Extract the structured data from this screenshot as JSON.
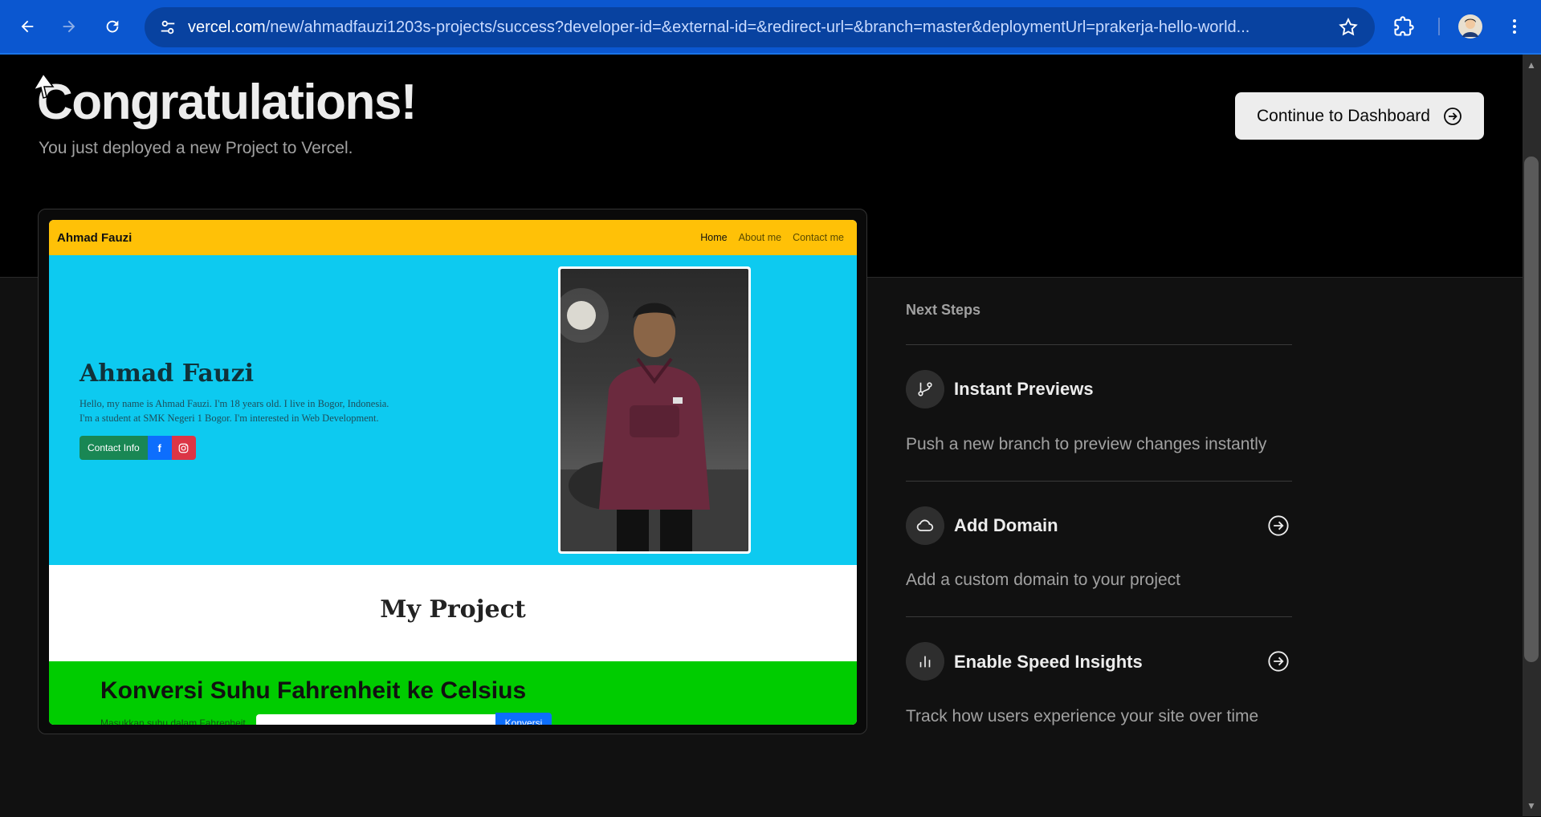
{
  "browser": {
    "url_host": "vercel.com",
    "url_path": "/new/ahmadfauzi1203s-projects/success?developer-id=&external-id=&redirect-url=&branch=master&deploymentUrl=prakerja-hello-world..."
  },
  "header": {
    "title": "Congratulations!",
    "subtitle": "You just deployed a new Project to Vercel.",
    "dashboard_button": "Continue to Dashboard"
  },
  "preview": {
    "brand": "Ahmad Fauzi",
    "nav": [
      "Home",
      "About me",
      "Contact me"
    ],
    "hero_name": "Ahmad Fauzi",
    "hero_desc_1": "Hello, my name is Ahmad Fauzi. I'm 18 years old. I live in Bogor, Indonesia.",
    "hero_desc_2": "I'm a student at SMK Negeri 1 Bogor. I'm interested in Web Development.",
    "contact_button": "Contact Info",
    "project_title": "My Project",
    "convert_title": "Konversi Suhu Fahrenheit ke Celsius",
    "convert_label": "Masukkan suhu dalam Fahrenheit",
    "convert_button": "Konversi"
  },
  "next_steps": {
    "heading": "Next Steps",
    "items": [
      {
        "title": "Instant Previews",
        "desc": "Push a new branch to preview changes instantly",
        "icon": "git-branch-icon"
      },
      {
        "title": "Add Domain",
        "desc": "Add a custom domain to your project",
        "icon": "cloud-icon"
      },
      {
        "title": "Enable Speed Insights",
        "desc": "Track how users experience your site over time",
        "icon": "bar-chart-icon"
      }
    ]
  },
  "colors": {
    "chrome_blue": "#0b57d0",
    "preview_nav": "#ffc107",
    "preview_hero": "#0dcaf0",
    "preview_convert": "#00cc00"
  }
}
